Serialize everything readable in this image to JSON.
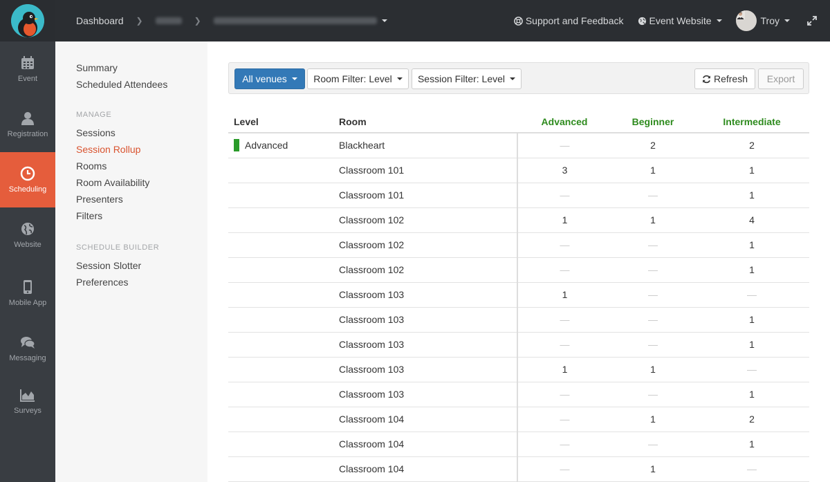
{
  "nav_rail": [
    {
      "label": "Event",
      "icon": "calendar-icon"
    },
    {
      "label": "Registration",
      "icon": "person-icon"
    },
    {
      "label": "Scheduling",
      "icon": "clock-icon",
      "active": true
    },
    {
      "label": "Website",
      "icon": "globe-icon"
    },
    {
      "label": "Mobile App",
      "icon": "phone-icon"
    },
    {
      "label": "Messaging",
      "icon": "chat-icon"
    },
    {
      "label": "Surveys",
      "icon": "area-chart-icon"
    }
  ],
  "header": {
    "breadcrumb_root": "Dashboard",
    "support": "Support and Feedback",
    "event_website": "Event Website",
    "user": "Troy"
  },
  "subnav": {
    "top_items": [
      "Summary",
      "Scheduled Attendees"
    ],
    "manage_heading": "MANAGE",
    "manage_items": [
      "Sessions",
      "Session Rollup",
      "Rooms",
      "Room Availability",
      "Presenters",
      "Filters"
    ],
    "active_item": "Session Rollup",
    "builder_heading": "SCHEDULE BUILDER",
    "builder_items": [
      "Session Slotter",
      "Preferences"
    ]
  },
  "toolbar": {
    "venues": "All venues",
    "room_filter": "Room Filter: Level",
    "session_filter": "Session Filter: Level",
    "refresh": "Refresh",
    "export": "Export"
  },
  "table": {
    "headers": [
      "Level",
      "Room",
      "Advanced",
      "Beginner",
      "Intermediate"
    ],
    "level_color": "#2a9b2a",
    "rows": [
      {
        "level": "Advanced",
        "room": "Blackheart",
        "advanced": "—",
        "beginner": "2",
        "intermediate": "2"
      },
      {
        "level": "",
        "room": "Classroom 101",
        "advanced": "3",
        "beginner": "1",
        "intermediate": "1"
      },
      {
        "level": "",
        "room": "Classroom 101",
        "advanced": "—",
        "beginner": "—",
        "intermediate": "1"
      },
      {
        "level": "",
        "room": "Classroom 102",
        "advanced": "1",
        "beginner": "1",
        "intermediate": "4"
      },
      {
        "level": "",
        "room": "Classroom 102",
        "advanced": "—",
        "beginner": "—",
        "intermediate": "1"
      },
      {
        "level": "",
        "room": "Classroom 102",
        "advanced": "—",
        "beginner": "—",
        "intermediate": "1"
      },
      {
        "level": "",
        "room": "Classroom 103",
        "advanced": "1",
        "beginner": "—",
        "intermediate": "—"
      },
      {
        "level": "",
        "room": "Classroom 103",
        "advanced": "—",
        "beginner": "—",
        "intermediate": "1"
      },
      {
        "level": "",
        "room": "Classroom 103",
        "advanced": "—",
        "beginner": "—",
        "intermediate": "1"
      },
      {
        "level": "",
        "room": "Classroom 103",
        "advanced": "1",
        "beginner": "1",
        "intermediate": "—"
      },
      {
        "level": "",
        "room": "Classroom 103",
        "advanced": "—",
        "beginner": "—",
        "intermediate": "1"
      },
      {
        "level": "",
        "room": "Classroom 104",
        "advanced": "—",
        "beginner": "1",
        "intermediate": "2"
      },
      {
        "level": "",
        "room": "Classroom 104",
        "advanced": "—",
        "beginner": "—",
        "intermediate": "1"
      },
      {
        "level": "",
        "room": "Classroom 104",
        "advanced": "—",
        "beginner": "1",
        "intermediate": "—"
      }
    ]
  }
}
